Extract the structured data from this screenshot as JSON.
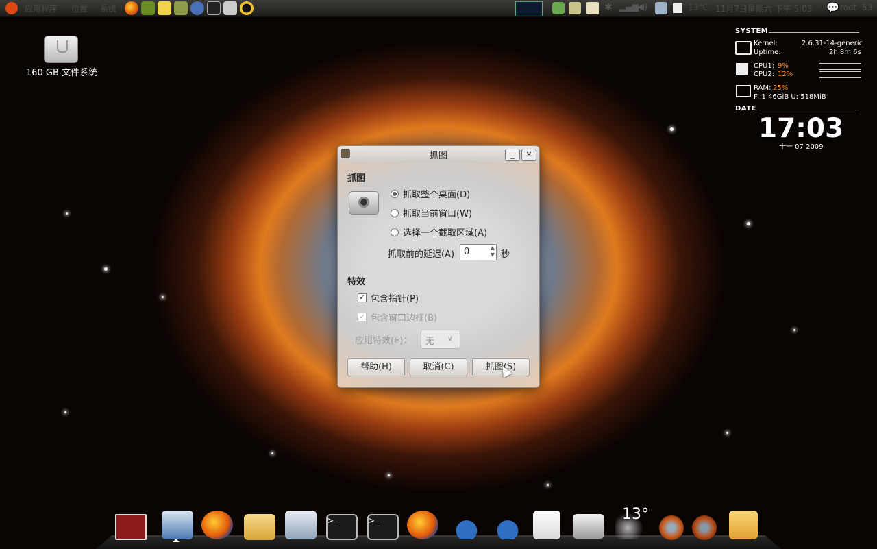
{
  "top_panel": {
    "menus": [
      "应用程序",
      "位置",
      "系统"
    ],
    "launchers": [
      "firefox-icon",
      "pidgin-icon",
      "note-icon",
      "books-icon",
      "people-icon",
      "terminal-icon",
      "camera-icon",
      "qq-icon"
    ],
    "temperature": "13°C",
    "datetime": "11月7日星期六 下午 5:03",
    "user": "root",
    "user_suffix": "53"
  },
  "desktop": {
    "drive_label": "160 GB 文件系统"
  },
  "conky": {
    "system_header": "SYSTEM",
    "kernel_label": "Kernel:",
    "kernel_value": "2.6.31-14-generic",
    "uptime_label": "Uptime:",
    "uptime_value": "2h 8m 6s",
    "cpu1_label": "CPU1:",
    "cpu1_value": "9%",
    "cpu2_label": "CPU2:",
    "cpu2_value": "12%",
    "ram_label": "RAM:",
    "ram_value": "25%",
    "fs_line": "F: 1.46GiB U: 518MiB",
    "date_header": "DATE",
    "time": "17:03",
    "date_line": "十一 07 2009"
  },
  "dialog": {
    "title": "抓图",
    "section_grab": "抓图",
    "opt_desktop": "抓取整个桌面(D)",
    "opt_window": "抓取当前窗口(W)",
    "opt_area": "选择一个截取区域(A)",
    "delay_label": "抓取前的延迟(A)",
    "delay_value": "0",
    "delay_unit": "秒",
    "section_effects": "特效",
    "include_pointer": "包含指针(P)",
    "include_border": "包含窗口边框(B)",
    "apply_effect_label": "应用特效(E)：",
    "apply_effect_value": "无",
    "help_button": "帮助(H)",
    "cancel_button": "取消(C)",
    "grab_button": "抓图(S)"
  },
  "dock": {
    "weather_temp": "13°",
    "items": [
      "presentation-icon",
      "save-icon",
      "firefox-icon",
      "folder-icon",
      "printer-icon",
      "terminal-icon",
      "terminal-icon-2",
      "firefox-icon-2",
      "footprint-icon",
      "footprint-icon-2",
      "text-editor-icon",
      "camera-icon",
      "weather-icon",
      "orb-icon",
      "orb-icon-2",
      "trash-icon"
    ]
  }
}
